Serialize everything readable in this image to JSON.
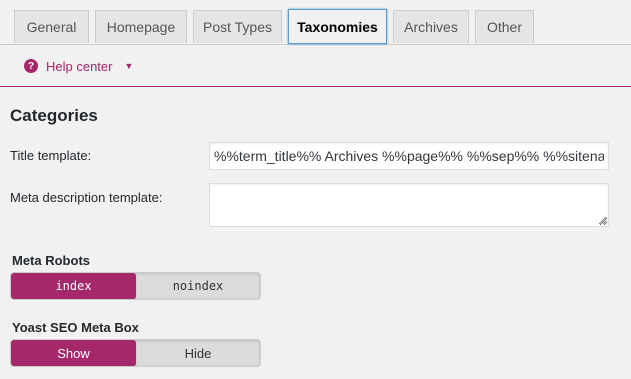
{
  "tabs": [
    {
      "label": "General",
      "active": false
    },
    {
      "label": "Homepage",
      "active": false
    },
    {
      "label": "Post Types",
      "active": false
    },
    {
      "label": "Taxonomies",
      "active": true
    },
    {
      "label": "Archives",
      "active": false
    },
    {
      "label": "Other",
      "active": false
    }
  ],
  "help": {
    "icon": "question-mark-icon",
    "label": "Help center",
    "caret_icon": "caret-down-icon"
  },
  "section": {
    "title": "Categories"
  },
  "fields": {
    "title_template": {
      "label": "Title template:",
      "value": "%%term_title%% Archives %%page%% %%sep%% %%sitename%%"
    },
    "meta_description": {
      "label": "Meta description template:",
      "value": ""
    }
  },
  "meta_robots": {
    "heading": "Meta Robots",
    "options": [
      "index",
      "noindex"
    ],
    "selected": "index"
  },
  "meta_box": {
    "heading": "Yoast SEO Meta Box",
    "options": [
      "Show",
      "Hide"
    ],
    "selected": "Show"
  },
  "colors": {
    "accent": "#a4286a",
    "background": "#f1f1f1",
    "focus": "#5b9dd9"
  }
}
